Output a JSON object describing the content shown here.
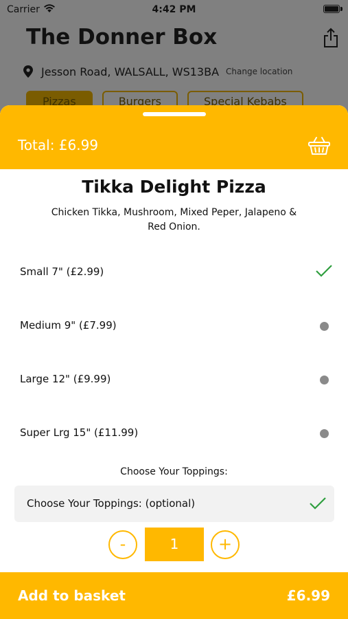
{
  "status_bar": {
    "carrier": "Carrier",
    "time": "4:42 PM"
  },
  "shop": {
    "name": "The Donner Box",
    "address": "Jesson Road, WALSALL, WS13BA",
    "change_location": "Change location",
    "categories": [
      "Pizzas",
      "Burgers",
      "Special Kebabs"
    ]
  },
  "sheet": {
    "total": "Total: £6.99",
    "item": {
      "name": "Tikka Delight Pizza",
      "description": "Chicken Tikka, Mushroom, Mixed Peper, Jalapeno & Red Onion."
    },
    "sizes": [
      {
        "label": "Small 7\" (£2.99)",
        "selected": true
      },
      {
        "label": "Medium 9\" (£7.99)",
        "selected": false
      },
      {
        "label": "Large 12\" (£9.99)",
        "selected": false
      },
      {
        "label": "Super Lrg 15\" (£11.99)",
        "selected": false
      }
    ],
    "toppings_heading": "Choose Your Toppings:",
    "toppings_option": "Choose Your Toppings: (optional)",
    "quantity": {
      "minus": "-",
      "value": "1",
      "plus": "+"
    },
    "add_to_basket": {
      "label": "Add to basket",
      "price": "£6.99"
    }
  },
  "colors": {
    "accent": "#ffb800",
    "check": "#2e9e3e",
    "dot": "#8a8a8a"
  },
  "icons": [
    "wifi-icon",
    "battery-icon",
    "share-icon",
    "location-pin-icon",
    "basket-icon",
    "checkmark-icon"
  ]
}
